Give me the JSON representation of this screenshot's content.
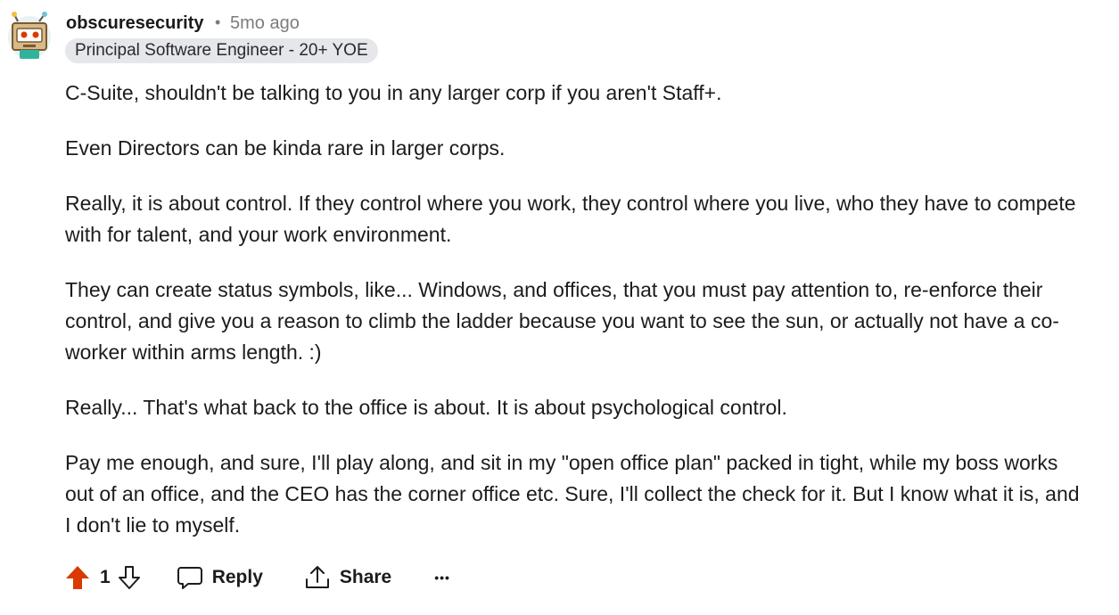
{
  "comment": {
    "author": "obscuresecurity",
    "separator": "•",
    "time_ago": "5mo ago",
    "flair": "Principal Software Engineer - 20+ YOE",
    "paragraphs": [
      "C-Suite, shouldn't be talking to you in any larger corp if you aren't Staff+.",
      "Even Directors can be kinda rare in larger corps.",
      "Really, it is about control. If they control where you work, they control where you live, who they have to compete with for talent, and your work environment.",
      "They can create status symbols, like... Windows, and offices, that you must pay attention to, re-enforce their control, and give you a reason to climb the ladder because you want to see the sun, or actually not have a co-worker within arms length. :)",
      "Really... That's what back to the office is about. It is about psychological control.",
      "Pay me enough, and sure, I'll play along, and sit in my \"open office plan\" packed in tight, while my boss works out of an office, and the CEO has the corner office etc. Sure, I'll collect the check for it. But I know what it is, and I don't lie to myself."
    ]
  },
  "actions": {
    "vote_count": "1",
    "reply_label": "Reply",
    "share_label": "Share",
    "more_label": "•••"
  },
  "icons": {
    "upvote": "upvote-arrow-icon",
    "downvote": "downvote-arrow-icon",
    "reply": "speech-bubble-icon",
    "share": "share-upload-icon",
    "avatar": "robot-avatar"
  },
  "colors": {
    "upvote_active": "#d93a00",
    "meta_gray": "#7c7c7c",
    "flair_bg": "#e5e7eb"
  }
}
